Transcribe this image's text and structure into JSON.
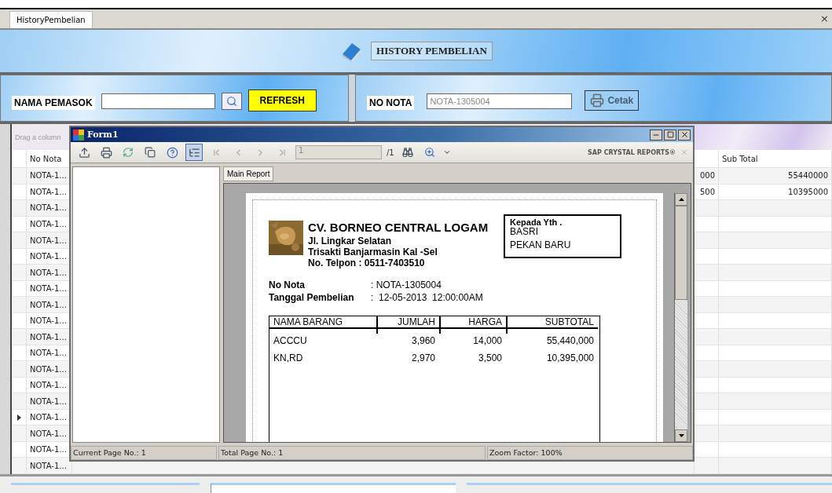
{
  "tabs": [
    {
      "label": "HistoryPembelian",
      "selected": true
    }
  ],
  "tab_close": "×",
  "header": {
    "title": "HISTORY PEMBELIAN"
  },
  "filter": {
    "supplier_label": "NAMA PEMASOK",
    "refresh_button": "REFRESH",
    "nota_label": "NO NOTA",
    "nota_value": "NOTA-1305004",
    "print_button": "Cetak"
  },
  "grid": {
    "group_hint": "Drag a column",
    "columns": {
      "no_nota": "No Nota",
      "sub_total": "Sub Total"
    },
    "rows": [
      {
        "no_nota": "NOTA-1...",
        "column_5": "000",
        "sub_total": "55440000",
        "selected": false
      },
      {
        "no_nota": "NOTA-1...",
        "column_5": "500",
        "sub_total": "10395000",
        "selected": false
      },
      {
        "no_nota": "NOTA-1...",
        "selected": false
      },
      {
        "no_nota": "NOTA-1...",
        "selected": false
      },
      {
        "no_nota": "NOTA-1...",
        "selected": false
      },
      {
        "no_nota": "NOTA-1...",
        "selected": false
      },
      {
        "no_nota": "NOTA-1...",
        "selected": false
      },
      {
        "no_nota": "NOTA-1...",
        "selected": false
      },
      {
        "no_nota": "NOTA-1...",
        "selected": false
      },
      {
        "no_nota": "NOTA-1...",
        "selected": false
      },
      {
        "no_nota": "NOTA-1...",
        "selected": false
      },
      {
        "no_nota": "NOTA-1...",
        "selected": false
      },
      {
        "no_nota": "NOTA-1...",
        "selected": false
      },
      {
        "no_nota": "NOTA-1...",
        "selected": false
      },
      {
        "no_nota": "NOTA-1...",
        "selected": false
      },
      {
        "no_nota": "NOTA-1...",
        "selected": true
      },
      {
        "no_nota": "NOTA-1...",
        "selected": false
      },
      {
        "no_nota": "NOTA-1...",
        "selected": false
      },
      {
        "no_nota": "NOTA-1...",
        "selected": false
      }
    ]
  },
  "report_window": {
    "title": "Form1",
    "toolbar": {
      "group_tree": true,
      "page": "1",
      "page_total": "/1",
      "brand": "SAP CRYSTAL REPORTS®"
    },
    "tab": "Main Report",
    "report": {
      "company": "CV. BORNEO CENTRAL LOGAM",
      "address": [
        "Jl. Lingkar Selatan",
        "Trisakti Banjarmasin Kal -Sel",
        "No. Telpon : 0511-7403510"
      ],
      "recipient": {
        "label": "Kepada Yth .",
        "name": "BASRI",
        "city": "PEKAN BARU"
      },
      "fields": [
        {
          "label": "No Nota",
          "value": ": NOTA-1305004"
        },
        {
          "label": "Tanggal Pembelian",
          "value": ":  12-05-2013  12:00:00AM"
        }
      ],
      "table": {
        "columns": [
          "NAMA BARANG",
          "JUMLAH",
          "HARGA",
          "SUBTOTAL"
        ],
        "rows": [
          [
            "ACCCU",
            "3,960",
            "14,000",
            "55,440,000"
          ],
          [
            "KN,RD",
            "2,970",
            "3,500",
            "10,395,000"
          ]
        ]
      }
    },
    "status": [
      "Current Page No.: 1",
      "Total Page No.: 1",
      "Zoom Factor: 100%"
    ]
  }
}
